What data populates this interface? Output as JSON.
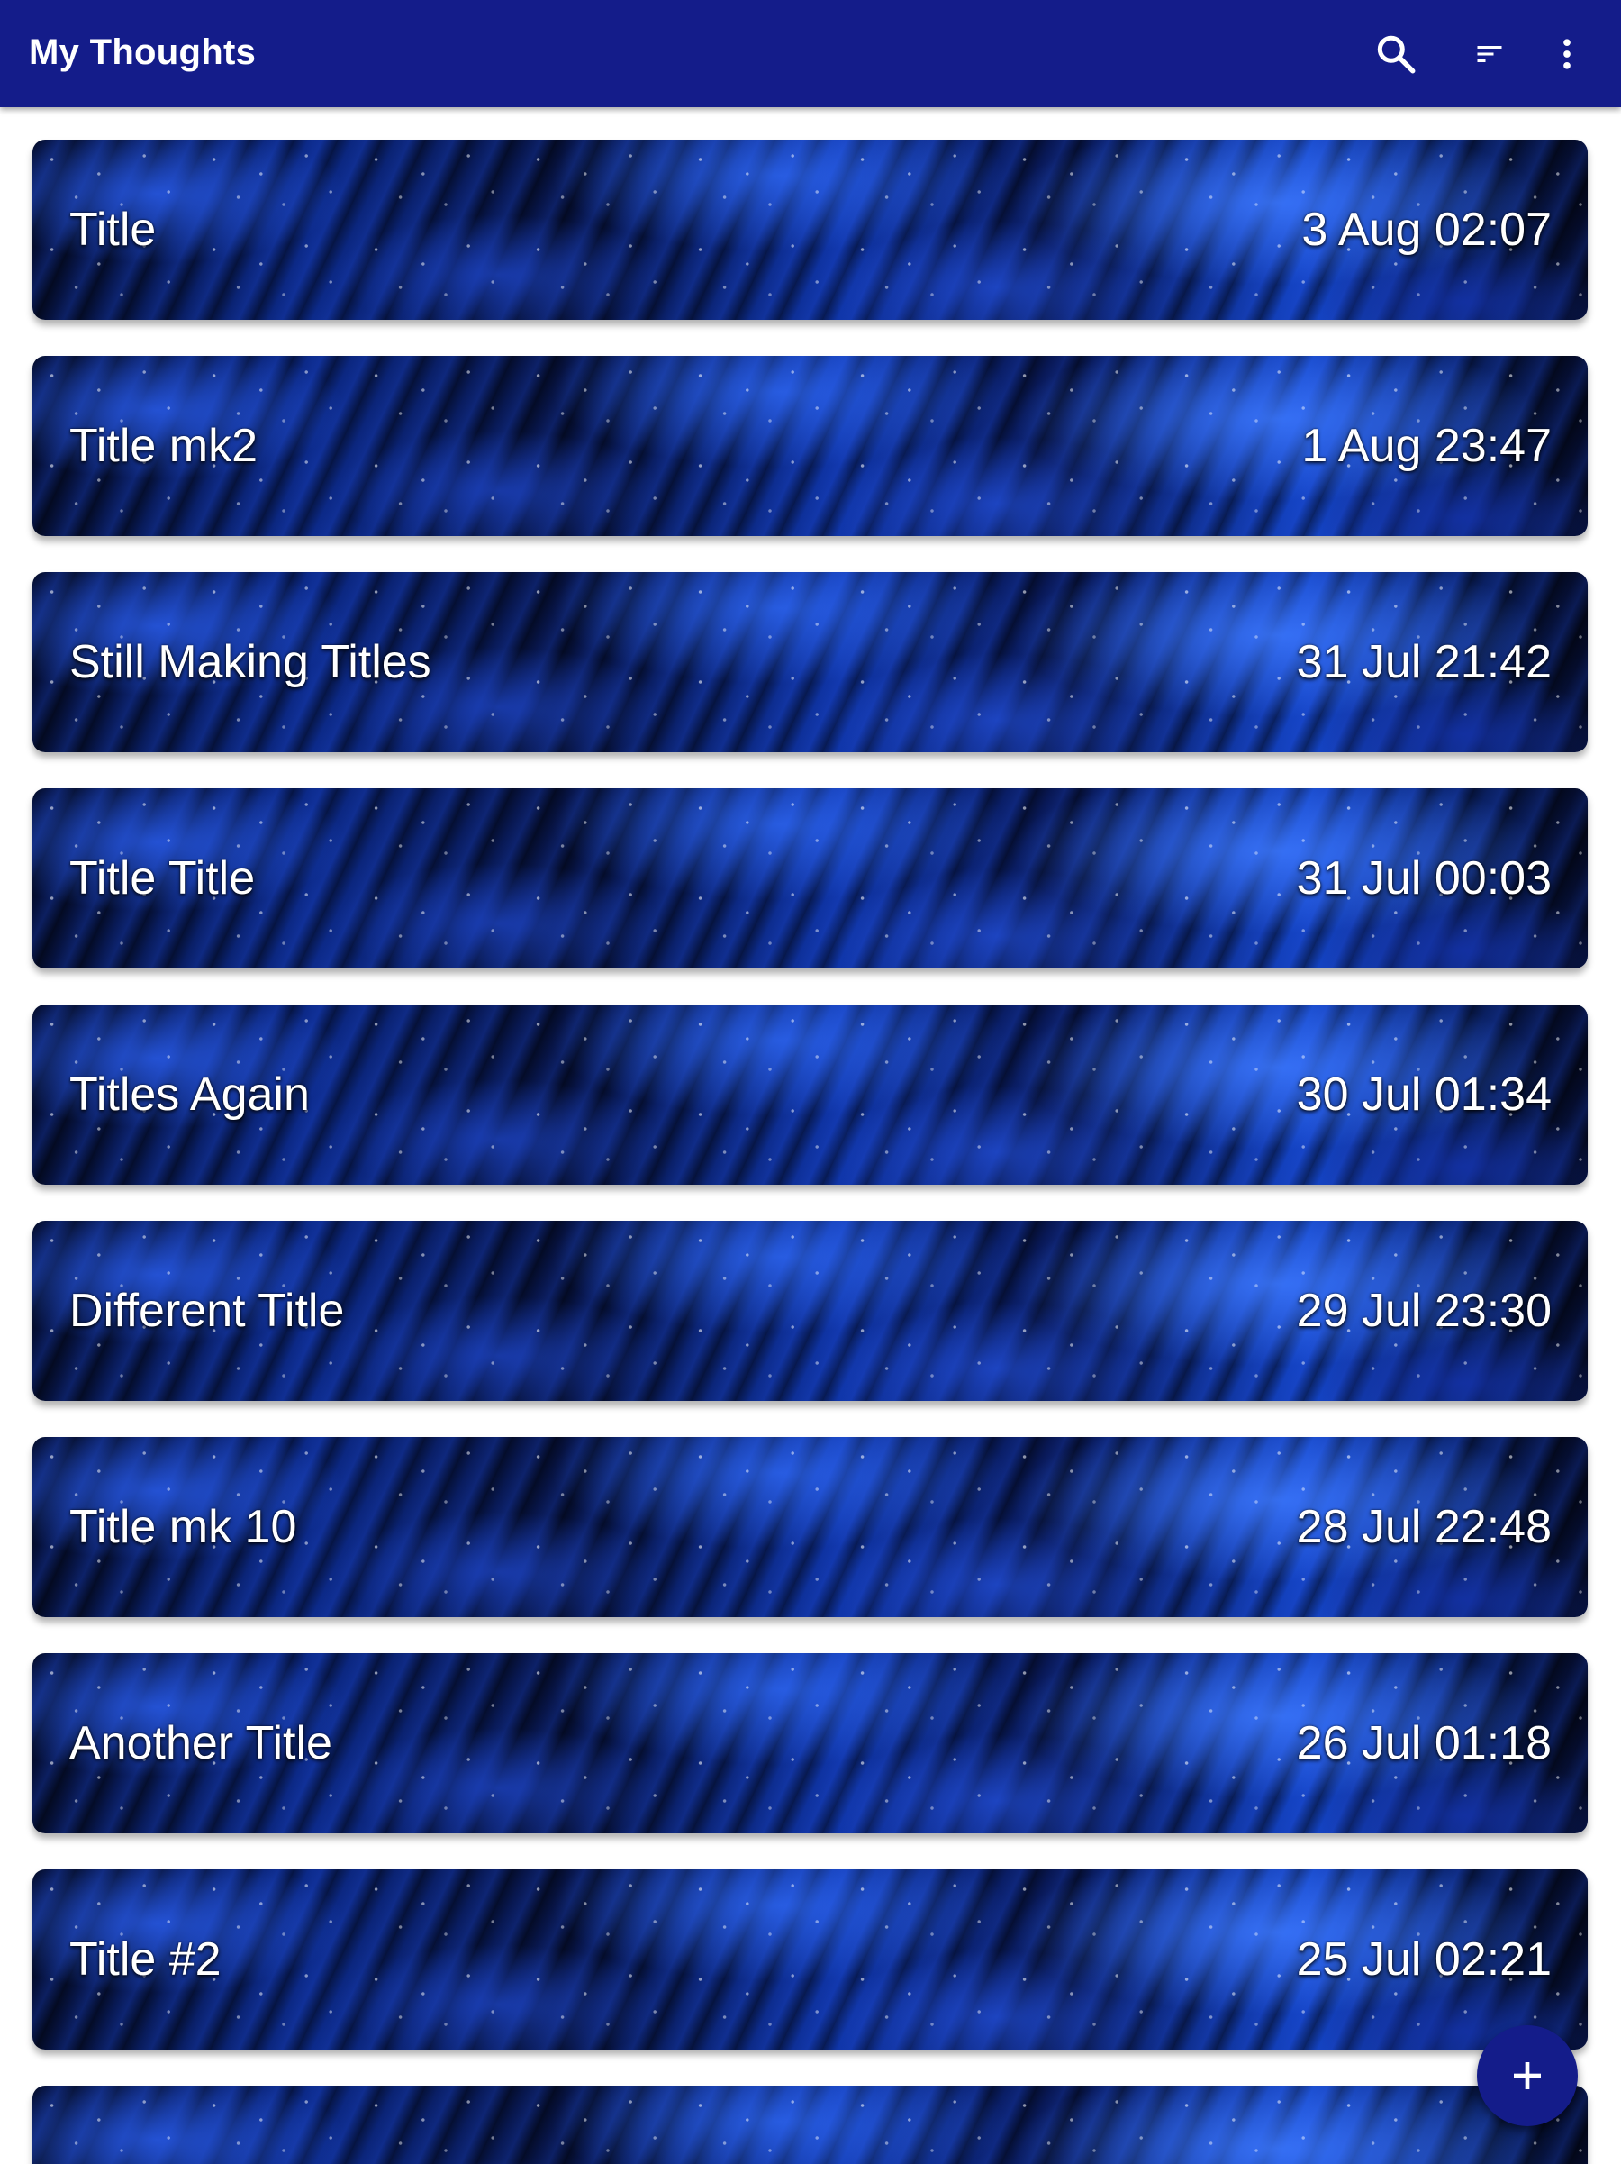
{
  "appbar": {
    "title": "My Thoughts",
    "background_color": "#141c8a",
    "actions": [
      {
        "icon": "search-icon"
      },
      {
        "icon": "sort-icon"
      },
      {
        "icon": "more-vert-icon"
      }
    ]
  },
  "notes": [
    {
      "title": "Title",
      "date": "3 Aug 02:07"
    },
    {
      "title": "Title mk2",
      "date": "1 Aug 23:47"
    },
    {
      "title": "Still Making Titles",
      "date": "31 Jul 21:42"
    },
    {
      "title": "Title Title",
      "date": "31 Jul 00:03"
    },
    {
      "title": "Titles Again",
      "date": "30 Jul 01:34"
    },
    {
      "title": "Different Title",
      "date": "29 Jul 23:30"
    },
    {
      "title": "Title mk 10",
      "date": "28 Jul 22:48"
    },
    {
      "title": "Another Title",
      "date": "26 Jul 01:18"
    },
    {
      "title": "Title #2",
      "date": "25 Jul 02:21"
    }
  ],
  "fab": {
    "icon": "add-icon",
    "color": "#141c8a"
  }
}
